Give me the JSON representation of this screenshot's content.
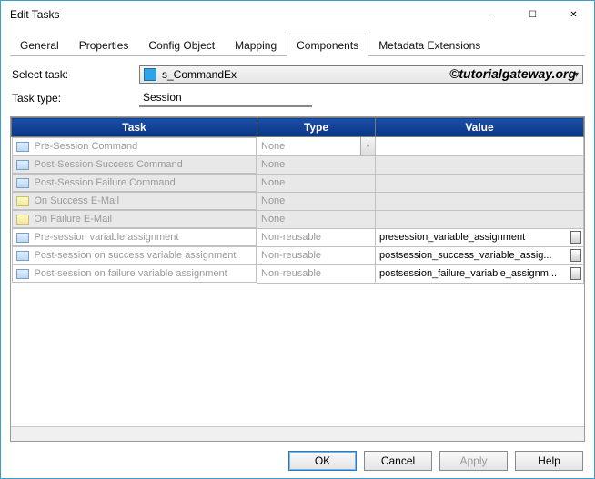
{
  "window": {
    "title": "Edit Tasks"
  },
  "tabs": {
    "items": [
      "General",
      "Properties",
      "Config Object",
      "Mapping",
      "Components",
      "Metadata Extensions"
    ],
    "active_index": 4
  },
  "form": {
    "select_task_label": "Select task:",
    "select_task_value": "s_CommandEx",
    "task_type_label": "Task type:",
    "task_type_value": "Session"
  },
  "watermark": "©tutorialgateway.org",
  "grid": {
    "headers": [
      "Task",
      "Type",
      "Value"
    ],
    "rows": [
      {
        "task": "Pre-Session Command",
        "type": "None",
        "value": "",
        "icon": "cmd",
        "dim_text": true,
        "dim_row": false,
        "dropdown": true,
        "edit": false
      },
      {
        "task": "Post-Session Success Command",
        "type": "None",
        "value": "",
        "icon": "cmd",
        "dim_text": true,
        "dim_row": true,
        "dropdown": false,
        "edit": false
      },
      {
        "task": "Post-Session Failure Command",
        "type": "None",
        "value": "",
        "icon": "cmd",
        "dim_text": true,
        "dim_row": true,
        "dropdown": false,
        "edit": false
      },
      {
        "task": "On Success E-Mail",
        "type": "None",
        "value": "",
        "icon": "mail",
        "dim_text": true,
        "dim_row": true,
        "dropdown": false,
        "edit": false
      },
      {
        "task": "On Failure E-Mail",
        "type": "None",
        "value": "",
        "icon": "mail",
        "dim_text": true,
        "dim_row": true,
        "dropdown": false,
        "edit": false
      },
      {
        "task": "Pre-session variable assignment",
        "type": "Non-reusable",
        "value": "presession_variable_assignment",
        "icon": "cmd",
        "dim_text": true,
        "dim_row": false,
        "dropdown": false,
        "edit": true
      },
      {
        "task": "Post-session on success variable assignment",
        "type": "Non-reusable",
        "value": "postsession_success_variable_assig...",
        "icon": "cmd",
        "dim_text": true,
        "dim_row": false,
        "dropdown": false,
        "edit": true
      },
      {
        "task": "Post-session on failure variable assignment",
        "type": "Non-reusable",
        "value": "postsession_failure_variable_assignm...",
        "icon": "cmd",
        "dim_text": true,
        "dim_row": false,
        "dropdown": false,
        "edit": true
      }
    ]
  },
  "footer": {
    "ok": "OK",
    "cancel": "Cancel",
    "apply": "Apply",
    "help": "Help"
  }
}
